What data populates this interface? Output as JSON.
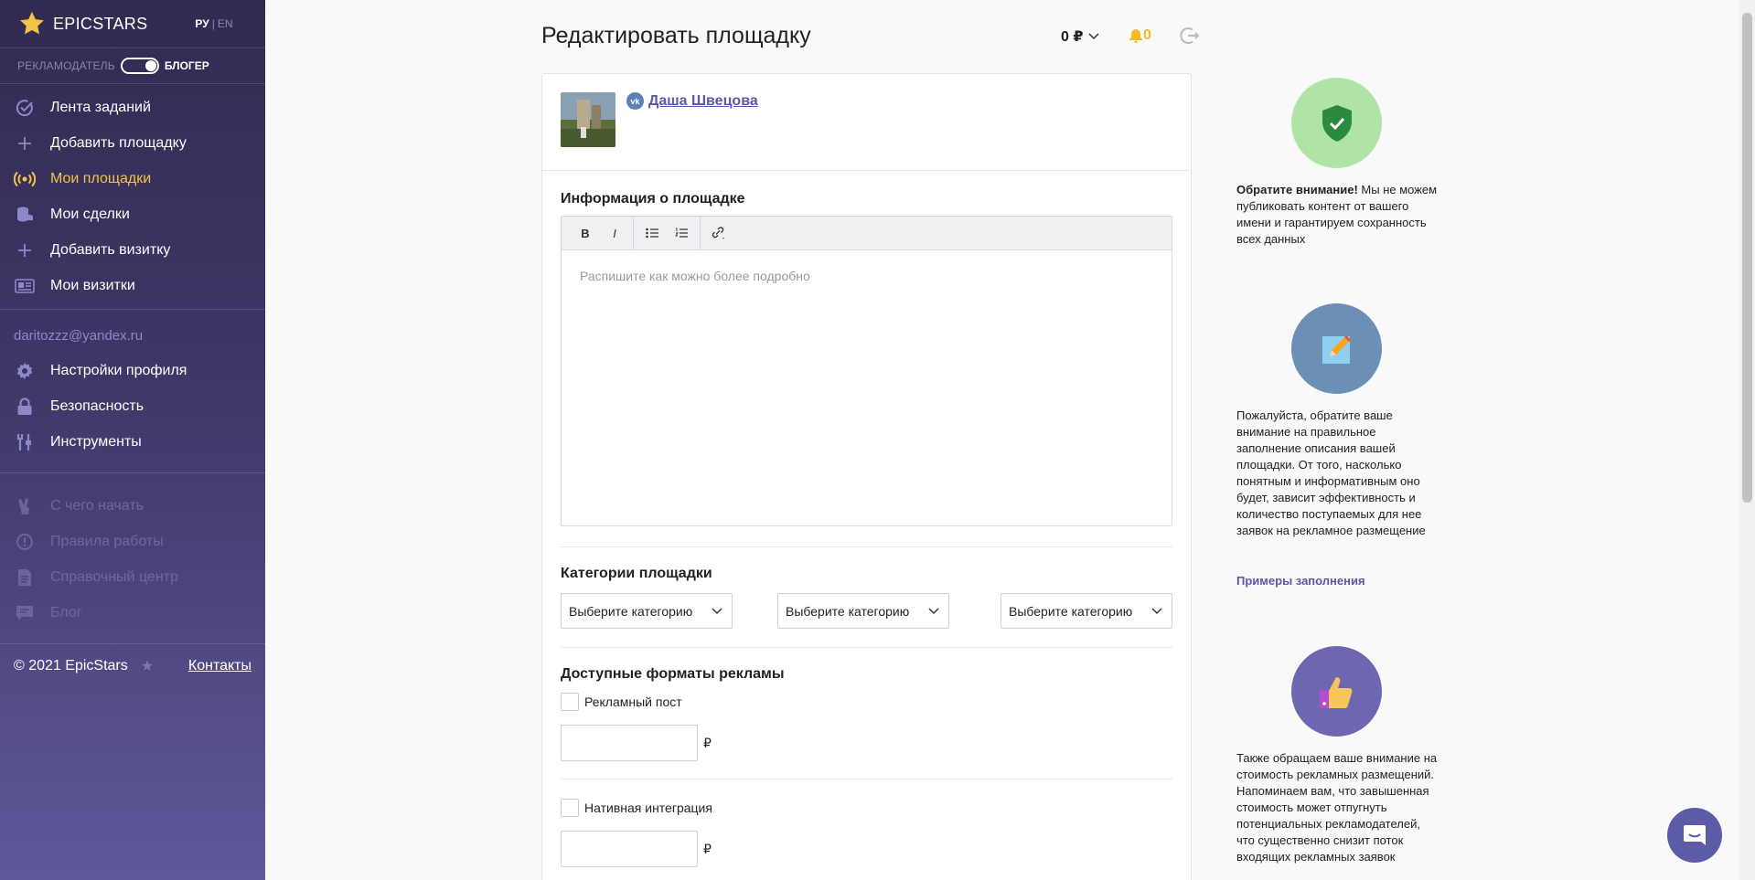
{
  "sidebar": {
    "logo_text": "EPICSTARS",
    "lang_active": "РУ",
    "lang_sep": "|",
    "lang_other": "EN",
    "role_advertiser": "РЕКЛАМОДАТЕЛЬ",
    "role_blogger": "БЛОГЕР",
    "menu": [
      {
        "label": "Лента заданий",
        "icon": "check-circle-icon"
      },
      {
        "label": "Добавить площадку",
        "icon": "plus-icon"
      },
      {
        "label": "Мои площадки",
        "icon": "broadcast-icon"
      },
      {
        "label": "Мои сделки",
        "icon": "coins-icon"
      },
      {
        "label": "Добавить визитку",
        "icon": "plus-icon"
      },
      {
        "label": "Мои визитки",
        "icon": "id-card-icon"
      }
    ],
    "email": "daritozzz@yandex.ru",
    "account_menu": [
      {
        "label": "Настройки профиля",
        "icon": "gear-icon"
      },
      {
        "label": "Безопасность",
        "icon": "lock-icon"
      },
      {
        "label": "Инструменты",
        "icon": "tools-icon"
      }
    ],
    "help_menu": [
      {
        "label": "С чего начать",
        "icon": "hand-icon"
      },
      {
        "label": "Правила работы",
        "icon": "alert-icon"
      },
      {
        "label": "Справочный центр",
        "icon": "document-icon"
      },
      {
        "label": "Блог",
        "icon": "blog-icon"
      }
    ],
    "copyright": "© 2021 EpicStars",
    "contacts": "Контакты"
  },
  "header": {
    "title": "Редактировать площадку",
    "balance": "0 ₽",
    "notifications": "0"
  },
  "profile": {
    "network": "vk",
    "name": "Даша Швецова"
  },
  "editor": {
    "label": "Информация о площадке",
    "bold": "B",
    "italic": "I",
    "placeholder": "Распишите как можно более подробно"
  },
  "categories": {
    "label": "Категории площадки",
    "select_placeholder": "Выберите категорию"
  },
  "formats": {
    "label": "Доступные форматы рекламы",
    "items": [
      {
        "label": "Рекламный пост",
        "currency": "₽"
      },
      {
        "label": "Нативная интеграция",
        "currency": "₽"
      }
    ]
  },
  "tips": {
    "tip1_bold": "Обратите внимание!",
    "tip1_text": " Мы не можем публиковать контент от вашего имени и гарантируем сохранность всех данных",
    "tip2_text": "Пожалуйста, обратите ваше внимание на правильное заполнение описания вашей площадки. От того, насколько понятным и информативным оно будет, зависит эффективность и количество поступаемых для нее заявок на рекламное размещение",
    "tip2_link": "Примеры заполнения",
    "tip3_text": "Также обращаем ваше внимание на стоимость рекламных размещений. Напоминаем вам, что завышенная стоимость может отпугнуть потенциальных рекламодателей, что существенно снизит поток входящих рекламных заявок"
  },
  "colors": {
    "accent": "#f5c343",
    "link": "#5a58a8",
    "sidebar_top": "#312b52",
    "sidebar_bottom": "#5f589a"
  }
}
